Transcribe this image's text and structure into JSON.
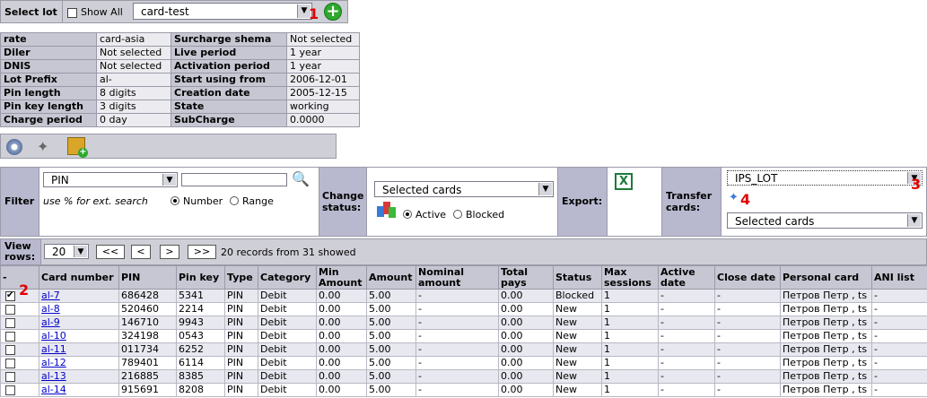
{
  "lot_bar": {
    "label": "Select lot",
    "show_all": "Show All",
    "lot_value": "card-test",
    "marker_1": "1"
  },
  "info": {
    "rows": [
      {
        "k1": "rate",
        "v1": "card-asia",
        "k2": "Surcharge shema",
        "v2": "Not selected"
      },
      {
        "k1": "Diler",
        "v1": "Not selected",
        "k2": "Live period",
        "v2": "1 year"
      },
      {
        "k1": "DNIS",
        "v1": "Not selected",
        "k2": "Activation period",
        "v2": "1 year"
      },
      {
        "k1": "Lot Prefix",
        "v1": "al-",
        "k2": "Start using from",
        "v2": "2006-12-01"
      },
      {
        "k1": "Pin length",
        "v1": "8 digits",
        "k2": "Creation date",
        "v2": "2005-12-15"
      },
      {
        "k1": "Pin key length",
        "v1": "3 digits",
        "k2": "State",
        "v2": "working"
      },
      {
        "k1": "Charge period",
        "v1": "0 day",
        "k2": "SubCharge",
        "v2": "0.0000"
      }
    ]
  },
  "filter": {
    "label": "Filter",
    "field": "PIN",
    "hint": "use % for ext. search",
    "number": "Number",
    "range": "Range",
    "change_status": "Change status:",
    "selected_cards": "Selected cards",
    "active": "Active",
    "blocked": "Blocked",
    "export": "Export:",
    "transfer": "Transfer cards:",
    "transfer_lot": "IPS_LOT",
    "transfer_selected": "Selected cards",
    "marker_3": "3",
    "marker_4": "4"
  },
  "view": {
    "label": "View rows:",
    "rows_value": "20",
    "first": "<<",
    "prev": "<",
    "next": ">",
    "last": ">>",
    "summary": "20 records from 31 showed"
  },
  "grid": {
    "marker_2": "2",
    "headers": [
      "-",
      "Card number",
      "PIN",
      "Pin key",
      "Type",
      "Category",
      "Min Amount",
      "Amount",
      "Nominal amount",
      "Total pays",
      "Status",
      "Max sessions",
      "Active date",
      "Close date",
      "Personal card",
      "ANI list"
    ],
    "rows": [
      {
        "checked": true,
        "card": "al-7",
        "pin": "686428",
        "key": "5341",
        "type": "PIN",
        "cat": "Debit",
        "min": "0.00",
        "amt": "5.00",
        "nom": "-",
        "tot": "0.00",
        "status": "Blocked",
        "max": "1",
        "act": "-",
        "close": "-",
        "pers": "Петров Петр , ts",
        "ani": "-"
      },
      {
        "checked": false,
        "card": "al-8",
        "pin": "520460",
        "key": "2214",
        "type": "PIN",
        "cat": "Debit",
        "min": "0.00",
        "amt": "5.00",
        "nom": "-",
        "tot": "0.00",
        "status": "New",
        "max": "1",
        "act": "-",
        "close": "-",
        "pers": "Петров Петр , ts",
        "ani": "-"
      },
      {
        "checked": false,
        "card": "al-9",
        "pin": "146710",
        "key": "9943",
        "type": "PIN",
        "cat": "Debit",
        "min": "0.00",
        "amt": "5.00",
        "nom": "-",
        "tot": "0.00",
        "status": "New",
        "max": "1",
        "act": "-",
        "close": "-",
        "pers": "Петров Петр , ts",
        "ani": "-"
      },
      {
        "checked": false,
        "card": "al-10",
        "pin": "324198",
        "key": "0543",
        "type": "PIN",
        "cat": "Debit",
        "min": "0.00",
        "amt": "5.00",
        "nom": "-",
        "tot": "0.00",
        "status": "New",
        "max": "1",
        "act": "-",
        "close": "-",
        "pers": "Петров Петр , ts",
        "ani": "-"
      },
      {
        "checked": false,
        "card": "al-11",
        "pin": "011734",
        "key": "6252",
        "type": "PIN",
        "cat": "Debit",
        "min": "0.00",
        "amt": "5.00",
        "nom": "-",
        "tot": "0.00",
        "status": "New",
        "max": "1",
        "act": "-",
        "close": "-",
        "pers": "Петров Петр , ts",
        "ani": "-"
      },
      {
        "checked": false,
        "card": "al-12",
        "pin": "789401",
        "key": "6114",
        "type": "PIN",
        "cat": "Debit",
        "min": "0.00",
        "amt": "5.00",
        "nom": "-",
        "tot": "0.00",
        "status": "New",
        "max": "1",
        "act": "-",
        "close": "-",
        "pers": "Петров Петр , ts",
        "ani": "-"
      },
      {
        "checked": false,
        "card": "al-13",
        "pin": "216885",
        "key": "8385",
        "type": "PIN",
        "cat": "Debit",
        "min": "0.00",
        "amt": "5.00",
        "nom": "-",
        "tot": "0.00",
        "status": "New",
        "max": "1",
        "act": "-",
        "close": "-",
        "pers": "Петров Петр , ts",
        "ani": "-"
      },
      {
        "checked": false,
        "card": "al-14",
        "pin": "915691",
        "key": "8208",
        "type": "PIN",
        "cat": "Debit",
        "min": "0.00",
        "amt": "5.00",
        "nom": "-",
        "tot": "0.00",
        "status": "New",
        "max": "1",
        "act": "-",
        "close": "-",
        "pers": "Петров Петр , ts",
        "ani": "-"
      }
    ]
  }
}
